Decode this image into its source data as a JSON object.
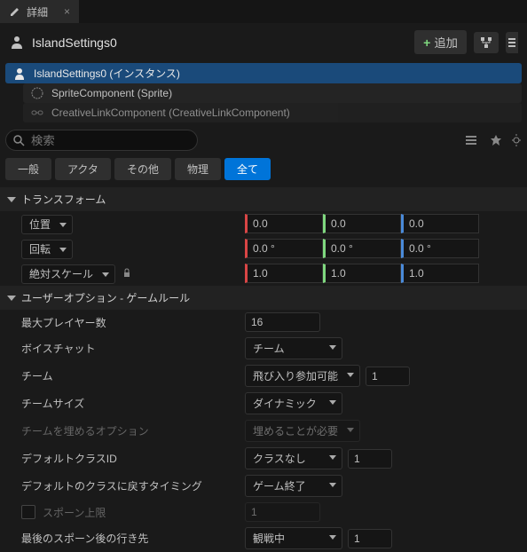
{
  "tab": {
    "title": "詳細"
  },
  "header": {
    "title": "IslandSettings0",
    "add_label": "追加"
  },
  "tree": {
    "root": "IslandSettings0 (インスタンス)",
    "child1": "SpriteComponent (Sprite)",
    "child2": "CreativeLinkComponent (CreativeLinkComponent)"
  },
  "search": {
    "placeholder": "検索"
  },
  "filters": {
    "general": "一般",
    "actor": "アクタ",
    "other": "その他",
    "physics": "物理",
    "all": "全て"
  },
  "sections": {
    "transform": "トランスフォーム",
    "useroptions": "ユーザーオプション - ゲームルール"
  },
  "transform": {
    "location_label": "位置",
    "rotation_label": "回転",
    "scale_label": "絶対スケール",
    "loc": {
      "x": "0.0",
      "y": "0.0",
      "z": "0.0"
    },
    "rot": {
      "x": "0.0 °",
      "y": "0.0 °",
      "z": "0.0 °"
    },
    "scale": {
      "x": "1.0",
      "y": "1.0",
      "z": "1.0"
    }
  },
  "gamerules": {
    "max_players_label": "最大プレイヤー数",
    "max_players_value": "16",
    "voice_chat_label": "ボイスチャット",
    "voice_chat_value": "チーム",
    "team_label": "チーム",
    "team_value": "飛び入り参加可能",
    "team_num": "1",
    "team_size_label": "チームサイズ",
    "team_size_value": "ダイナミック",
    "fill_team_label": "チームを埋めるオプション",
    "fill_team_value": "埋めることが必要",
    "default_class_label": "デフォルトクラスID",
    "default_class_value": "クラスなし",
    "default_class_num": "1",
    "revert_class_label": "デフォルトのクラスに戻すタイミング",
    "revert_class_value": "ゲーム終了",
    "spawn_cap_label": "スポーン上限",
    "spawn_cap_value": "1",
    "after_last_spawn_label": "最後のスポーン後の行き先",
    "after_last_spawn_value": "観戦中",
    "after_last_spawn_num": "1"
  }
}
